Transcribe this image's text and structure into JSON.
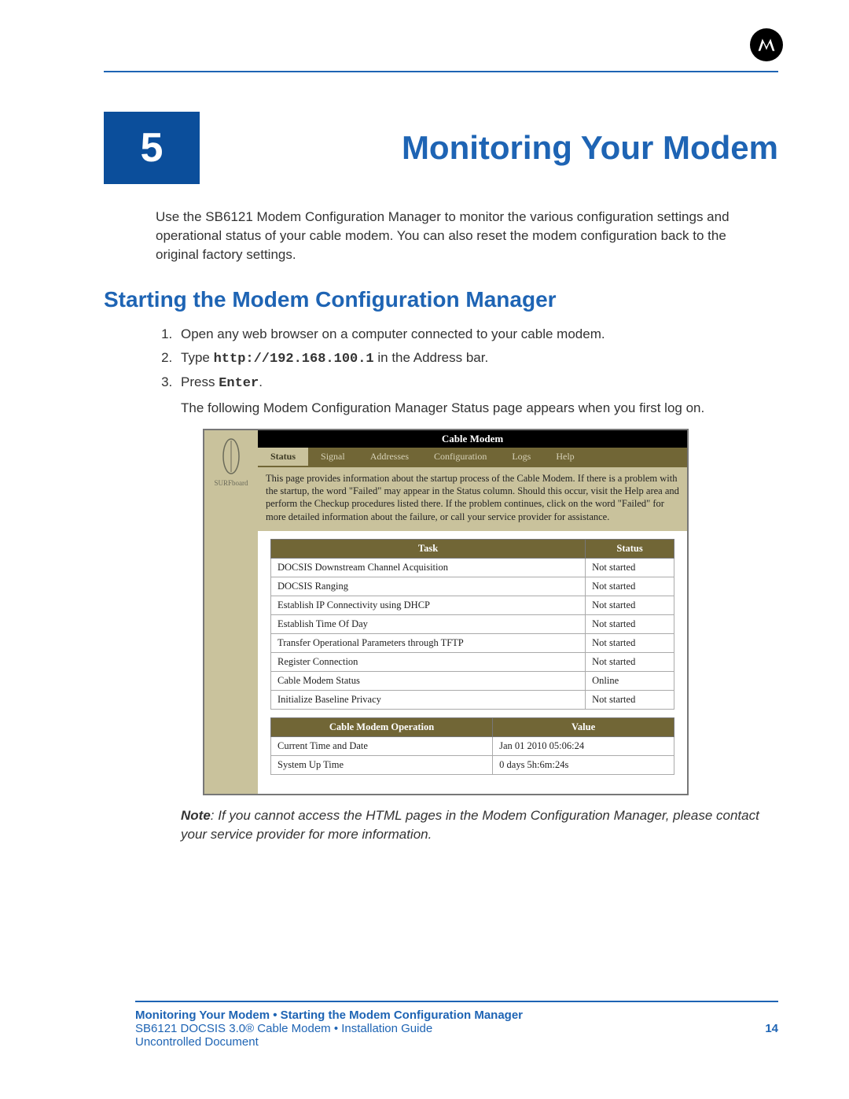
{
  "chapter": {
    "number": "5",
    "title": "Monitoring Your Modem"
  },
  "intro_paragraph": "Use the SB6121 Modem Configuration Manager to monitor the various configuration settings and operational status of your cable modem. You can also reset the modem configuration back to the original factory settings.",
  "section_heading": "Starting the Modem Configuration Manager",
  "steps": {
    "s1": "Open any web browser on a computer connected to your cable modem.",
    "s2_pre": "Type ",
    "s2_code": "http://192.168.100.1",
    "s2_post": " in the Address bar.",
    "s3_pre": "Press ",
    "s3_code": "Enter",
    "s3_post": "."
  },
  "post_steps_note": "The following Modem Configuration Manager Status page appears when you first log on.",
  "modem_ui": {
    "sidebar_label": "SURFboard",
    "header": "Cable Modem",
    "tabs": [
      "Status",
      "Signal",
      "Addresses",
      "Configuration",
      "Logs",
      "Help"
    ],
    "intro": "This page provides information about the startup process of the Cable Modem. If there is a problem with the startup, the word \"Failed\" may appear in the Status column. Should this occur, visit the Help area and perform the Checkup procedures listed there. If the problem continues, click on the word \"Failed\" for more detailed information about the failure, or call your service provider for assistance.",
    "task_table": {
      "headers": [
        "Task",
        "Status"
      ],
      "rows": [
        [
          "DOCSIS Downstream Channel Acquisition",
          "Not started"
        ],
        [
          "DOCSIS Ranging",
          "Not started"
        ],
        [
          "Establish IP Connectivity using DHCP",
          "Not started"
        ],
        [
          "Establish Time Of Day",
          "Not started"
        ],
        [
          "Transfer Operational Parameters through TFTP",
          "Not started"
        ],
        [
          "Register Connection",
          "Not started"
        ],
        [
          "Cable Modem Status",
          "Online"
        ],
        [
          "Initialize Baseline Privacy",
          "Not started"
        ]
      ]
    },
    "op_table": {
      "headers": [
        "Cable Modem Operation",
        "Value"
      ],
      "rows": [
        [
          "Current Time and Date",
          "Jan 01 2010 05:06:24"
        ],
        [
          "System Up Time",
          "0 days 5h:6m:24s"
        ]
      ]
    }
  },
  "italic_note_bold": "Note",
  "italic_note_rest": ": If you cannot access the HTML pages in the Modem Configuration Manager, please contact your service provider for more information.",
  "footer": {
    "breadcrumb": "Monitoring Your Modem • Starting the Modem Configuration Manager",
    "guide": "SB6121 DOCSIS 3.0® Cable Modem • Installation Guide",
    "page_number": "14",
    "status": "Uncontrolled Document"
  }
}
